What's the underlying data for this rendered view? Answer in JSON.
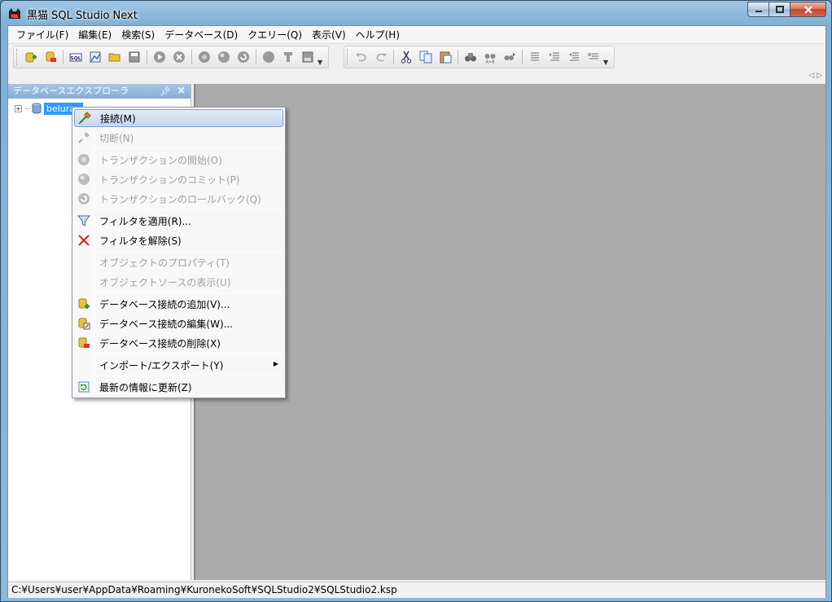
{
  "window": {
    "title": "黒猫 SQL Studio Next"
  },
  "menubar": [
    "ファイル(F)",
    "編集(E)",
    "検索(S)",
    "データベース(D)",
    "クエリー(Q)",
    "表示(V)",
    "ヘルプ(H)"
  ],
  "toolbar_icons": {
    "main": [
      "add-connection-icon",
      "delete-connection-icon",
      "new-sql-icon",
      "chart-icon",
      "open-folder-icon",
      "save-icon",
      "run-icon",
      "stop-icon",
      "begin-transaction-icon",
      "commit-icon",
      "rollback-icon",
      "record-icon",
      "format-icon",
      "save-script-icon"
    ],
    "edit": [
      "undo-icon",
      "redo-icon",
      "cut-icon",
      "copy-icon",
      "paste-icon",
      "find-icon",
      "replace-icon",
      "find-next-icon",
      "align-icon",
      "indent-icon",
      "outdent-icon",
      "comment-icon"
    ]
  },
  "explorer": {
    "title": "データベースエクスプローラ",
    "tree": [
      {
        "label": "belurao",
        "expander": "+"
      }
    ]
  },
  "context_menu": {
    "items": [
      {
        "label": "接続(M)",
        "icon": "connect-icon",
        "disabled": false,
        "highlighted": true
      },
      {
        "label": "切断(N)",
        "icon": "disconnect-icon",
        "disabled": true
      },
      {
        "label": "トランザクションの開始(O)",
        "icon": "begin-transaction-icon",
        "disabled": true
      },
      {
        "label": "トランザクションのコミット(P)",
        "icon": "commit-icon",
        "disabled": true
      },
      {
        "label": "トランザクションのロールバック(Q)",
        "icon": "rollback-icon",
        "disabled": true
      },
      {
        "label": "フィルタを適用(R)...",
        "icon": "filter-icon",
        "disabled": false
      },
      {
        "label": "フィルタを解除(S)",
        "icon": "clear-filter-icon",
        "disabled": false
      },
      {
        "label": "オブジェクトのプロパティ(T)",
        "icon": "",
        "disabled": true
      },
      {
        "label": "オブジェクトソースの表示(U)",
        "icon": "",
        "disabled": true
      },
      {
        "label": "データベース接続の追加(V)...",
        "icon": "add-connection-icon",
        "disabled": false
      },
      {
        "label": "データベース接続の編集(W)...",
        "icon": "edit-connection-icon",
        "disabled": false
      },
      {
        "label": "データベース接続の削除(X)",
        "icon": "delete-connection-icon",
        "disabled": false
      },
      {
        "label": "インポート/エクスポート(Y)",
        "icon": "",
        "disabled": false,
        "submenu": true
      },
      {
        "label": "最新の情報に更新(Z)",
        "icon": "refresh-icon",
        "disabled": false
      }
    ]
  },
  "statusbar": {
    "text": "C:¥Users¥user¥AppData¥Roaming¥KuronekoSoft¥SQLStudio2¥SQLStudio2.ksp"
  }
}
